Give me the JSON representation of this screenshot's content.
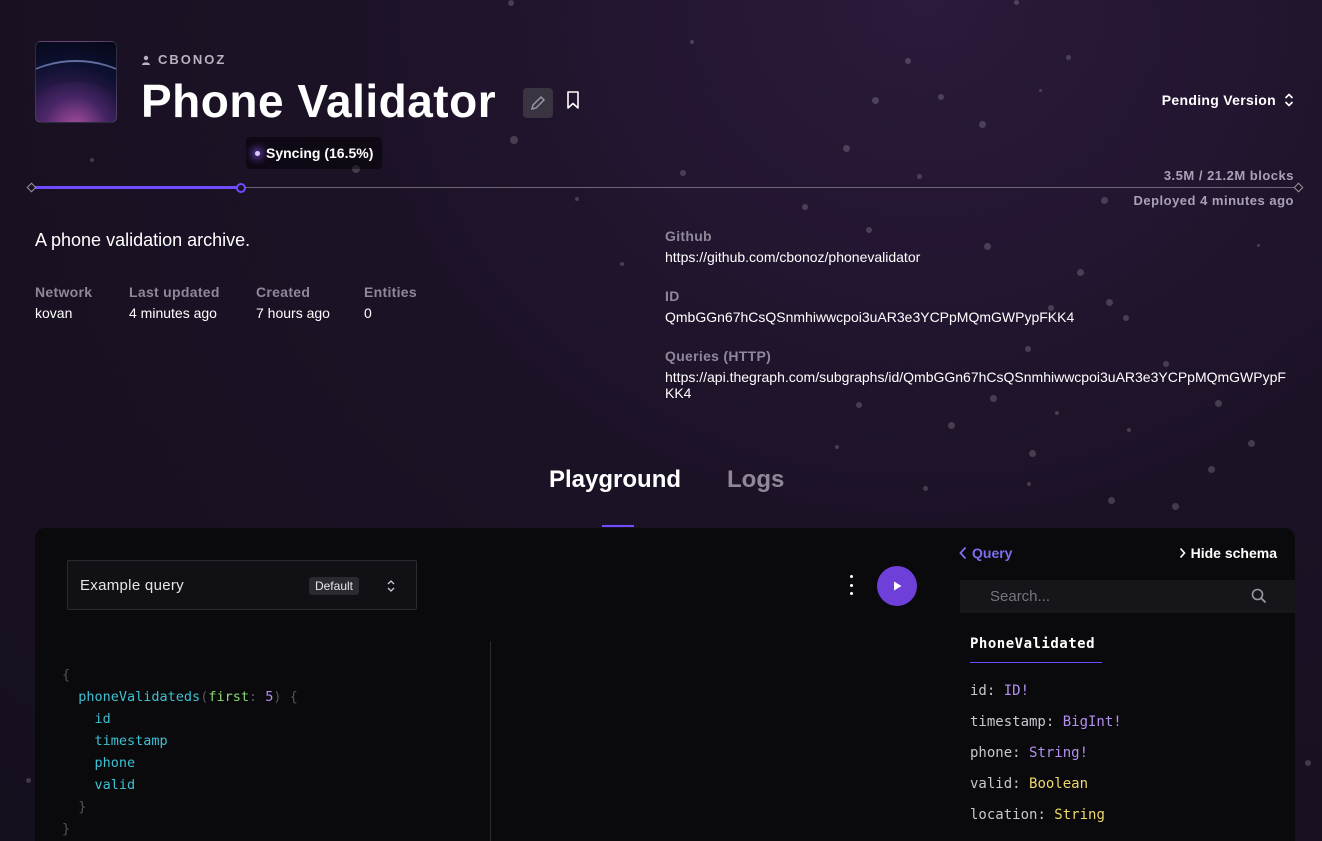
{
  "owner": {
    "name": "CBONOZ"
  },
  "subgraph": {
    "title": "Phone Validator",
    "description": "A phone validation archive."
  },
  "version": {
    "label": "Pending Version"
  },
  "sync": {
    "status": "Syncing (16.5%)",
    "progress_fraction": 0.165,
    "blocks": "3.5M / 21.2M blocks",
    "deployed": "Deployed 4 minutes ago"
  },
  "meta": [
    {
      "label": "Network",
      "value": "kovan"
    },
    {
      "label": "Last updated",
      "value": "4 minutes ago"
    },
    {
      "label": "Created",
      "value": "7 hours ago"
    },
    {
      "label": "Entities",
      "value": "0"
    }
  ],
  "info": {
    "github": {
      "label": "Github",
      "value": "https://github.com/cbonoz/phonevalidator"
    },
    "id": {
      "label": "ID",
      "value": "QmbGGn67hCsQSnmhiwwcpoi3uAR3e3YCPpMQmGWPypFKK4"
    },
    "queries": {
      "label": "Queries (HTTP)",
      "value": "https://api.thegraph.com/subgraphs/id/QmbGGn67hCsQSnmhiwwcpoi3uAR3e3YCPpMQmGWPypFKK4"
    }
  },
  "tabs": [
    {
      "label": "Playground",
      "active": true
    },
    {
      "label": "Logs",
      "active": false
    }
  ],
  "playground": {
    "query_name": "Example query",
    "query_badge": "Default",
    "code": {
      "open_brace": "{",
      "entity": "phoneValidateds",
      "arg_name": "first",
      "arg_value": "5",
      "fields": [
        "id",
        "timestamp",
        "phone",
        "valid"
      ],
      "close_inner": "}",
      "close_outer": "}"
    }
  },
  "schema": {
    "back_label": "Query",
    "hide_label": "Hide schema",
    "search_placeholder": "Search...",
    "type_name": "PhoneValidated",
    "fields": [
      {
        "name": "id",
        "type": "ID!"
      },
      {
        "name": "timestamp",
        "type": "BigInt!"
      },
      {
        "name": "phone",
        "type": "String!"
      },
      {
        "name": "valid",
        "type": "Boolean"
      },
      {
        "name": "location",
        "type": "String"
      }
    ]
  },
  "colors": {
    "accent": "#6f4cff",
    "background": "#1c1226",
    "run_button": "#6f3fd9"
  }
}
